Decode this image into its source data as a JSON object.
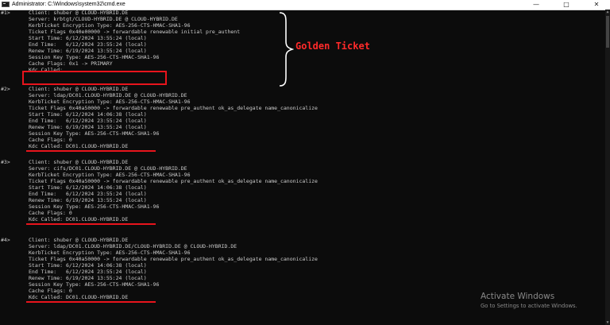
{
  "window": {
    "title": "Administrator: C:\\Windows\\system32\\cmd.exe",
    "minimize_glyph": "—",
    "maximize_glyph": "□",
    "close_glyph": "✕"
  },
  "tickets": [
    {
      "index": "#1>",
      "lines": [
        "Client: shuber @ CLOUD-HYBRID.DE",
        "Server: krbtgt/CLOUD-HYBRID.DE @ CLOUD-HYBRID.DE",
        "KerbTicket Encryption Type: AES-256-CTS-HMAC-SHA1-96",
        "Ticket Flags 0x40e00000 -> forwardable renewable initial pre_authent",
        "Start Time: 6/12/2024 13:55:24 (local)",
        "End Time:   6/12/2024 23:55:24 (local)",
        "Renew Time: 6/19/2024 13:55:24 (local)",
        "Session Key Type: AES-256-CTS-HMAC-SHA1-96",
        "Cache Flags: 0x1 -> PRIMARY",
        "Kdc Called:"
      ]
    },
    {
      "index": "#2>",
      "lines": [
        "Client: shuber @ CLOUD-HYBRID.DE",
        "Server: ldap/DC01.CLOUD-HYBRID.DE @ CLOUD-HYBRID.DE",
        "KerbTicket Encryption Type: AES-256-CTS-HMAC-SHA1-96",
        "Ticket Flags 0x40a50000 -> forwardable renewable pre_authent ok_as_delegate name_canonicalize",
        "Start Time: 6/12/2024 14:06:38 (local)",
        "End Time:   6/12/2024 23:55:24 (local)",
        "Renew Time: 6/19/2024 13:55:24 (local)",
        "Session Key Type: AES-256-CTS-HMAC-SHA1-96",
        "Cache Flags: 0",
        "Kdc Called: DC01.CLOUD-HYBRID.DE"
      ]
    },
    {
      "index": "#3>",
      "lines": [
        "Client: shuber @ CLOUD-HYBRID.DE",
        "Server: cifs/DC01.CLOUD-HYBRID.DE @ CLOUD-HYBRID.DE",
        "KerbTicket Encryption Type: AES-256-CTS-HMAC-SHA1-96",
        "Ticket Flags 0x40a50000 -> forwardable renewable pre_authent ok_as_delegate name_canonicalize",
        "Start Time: 6/12/2024 14:06:38 (local)",
        "End Time:   6/12/2024 23:55:24 (local)",
        "Renew Time: 6/19/2024 13:55:24 (local)",
        "Session Key Type: AES-256-CTS-HMAC-SHA1-96",
        "Cache Flags: 0",
        "Kdc Called: DC01.CLOUD-HYBRID.DE"
      ]
    },
    {
      "index": "#4>",
      "lines": [
        "Client: shuber @ CLOUD-HYBRID.DE",
        "Server: ldap/DC01.CLOUD-HYBRID.DE/CLOUD-HYBRID.DE @ CLOUD-HYBRID.DE",
        "KerbTicket Encryption Type: AES-256-CTS-HMAC-SHA1-96",
        "Ticket Flags 0x40a50000 -> forwardable renewable pre_authent ok_as_delegate name_canonicalize",
        "Start Time: 6/12/2024 14:06:38 (local)",
        "End Time:   6/12/2024 23:55:24 (local)",
        "Renew Time: 6/19/2024 13:55:24 (local)",
        "Session Key Type: AES-256-CTS-HMAC-SHA1-96",
        "Cache Flags: 0",
        "Kdc Called: DC01.CLOUD-HYBRID.DE"
      ]
    }
  ],
  "annotation": {
    "label": "Golden Ticket"
  },
  "watermark": {
    "title": "Activate Windows",
    "subtitle": "Go to Settings to activate Windows."
  },
  "colors": {
    "console_bg": "#0c0c0c",
    "console_text": "#cccccc",
    "annotation_red": "#e8141c"
  }
}
